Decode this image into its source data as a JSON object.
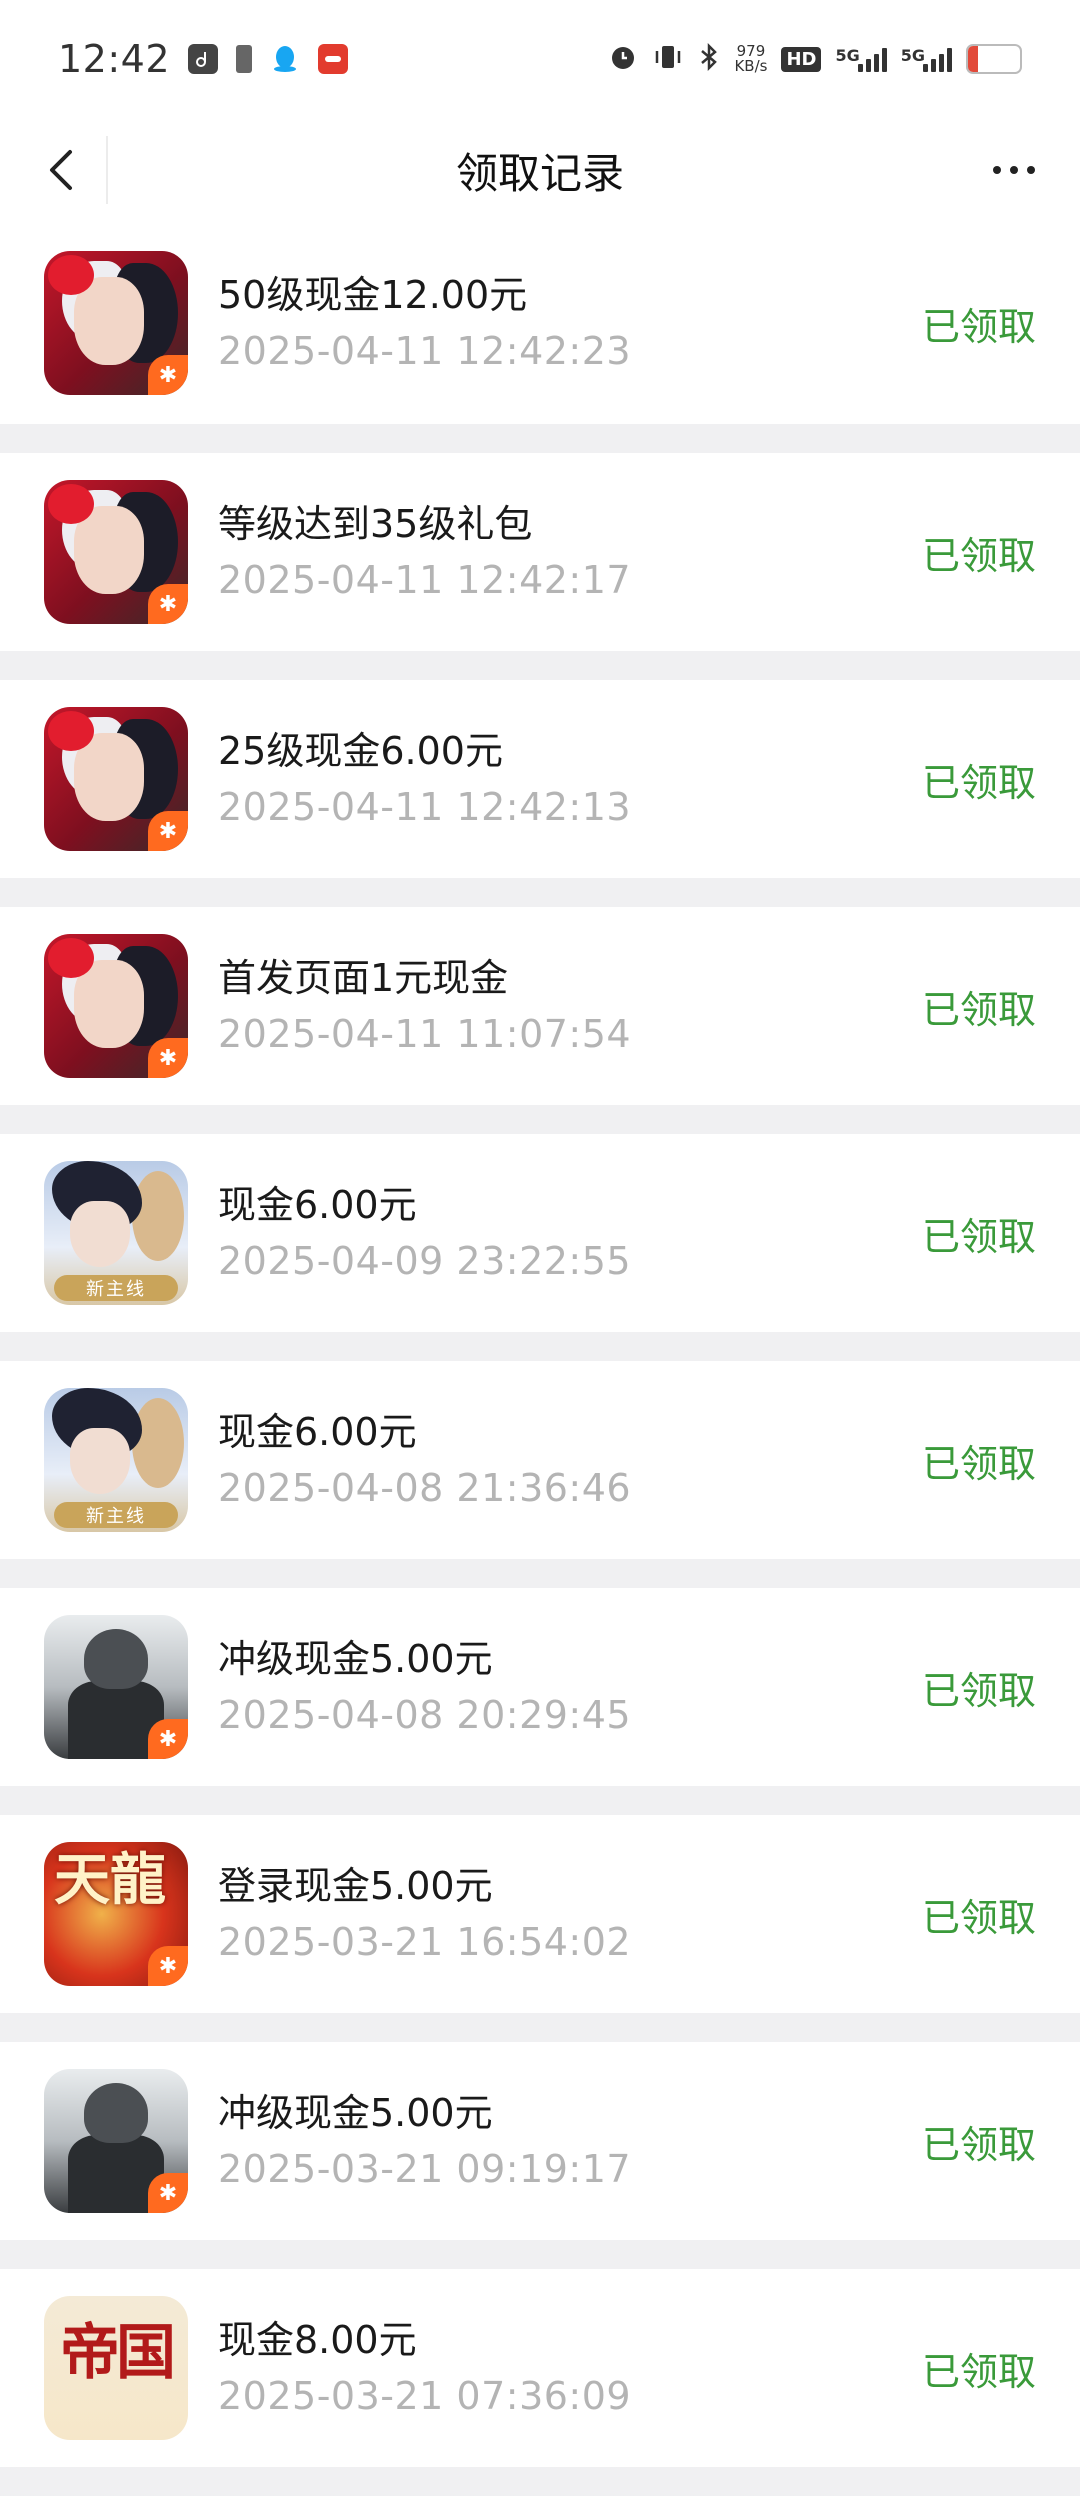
{
  "status_bar": {
    "time": "12:42",
    "net_speed_value": "979",
    "net_speed_unit": "KB/s",
    "hd_label": "HD",
    "sim1_label": "5G",
    "sim2_label": "5G",
    "battery_level": "14"
  },
  "nav": {
    "title": "领取记录"
  },
  "icon_badges": {
    "boy_banner": "新主线",
    "dragon_text": "天龍",
    "empire_text": "帝国"
  },
  "records": [
    {
      "icon": "ic-red",
      "title": "50级现金12.00元",
      "time": "2025-04-11 12:42:23",
      "status": "已领取"
    },
    {
      "icon": "ic-red",
      "title": "等级达到35级礼包",
      "time": "2025-04-11 12:42:17",
      "status": "已领取"
    },
    {
      "icon": "ic-red",
      "title": "25级现金6.00元",
      "time": "2025-04-11 12:42:13",
      "status": "已领取"
    },
    {
      "icon": "ic-red",
      "title": "首发页面1元现金",
      "time": "2025-04-11 11:07:54",
      "status": "已领取"
    },
    {
      "icon": "ic-boy",
      "title": "现金6.00元",
      "time": "2025-04-09 23:22:55",
      "status": "已领取"
    },
    {
      "icon": "ic-boy",
      "title": "现金6.00元",
      "time": "2025-04-08 21:36:46",
      "status": "已领取"
    },
    {
      "icon": "ic-sold",
      "title": "冲级现金5.00元",
      "time": "2025-04-08 20:29:45",
      "status": "已领取"
    },
    {
      "icon": "ic-dragon",
      "title": "登录现金5.00元",
      "time": "2025-03-21 16:54:02",
      "status": "已领取"
    },
    {
      "icon": "ic-sold",
      "title": "冲级现金5.00元",
      "time": "2025-03-21 09:19:17",
      "status": "已领取"
    },
    {
      "icon": "ic-empire",
      "title": "现金8.00元",
      "time": "2025-03-21 07:36:09",
      "status": "已领取"
    }
  ]
}
